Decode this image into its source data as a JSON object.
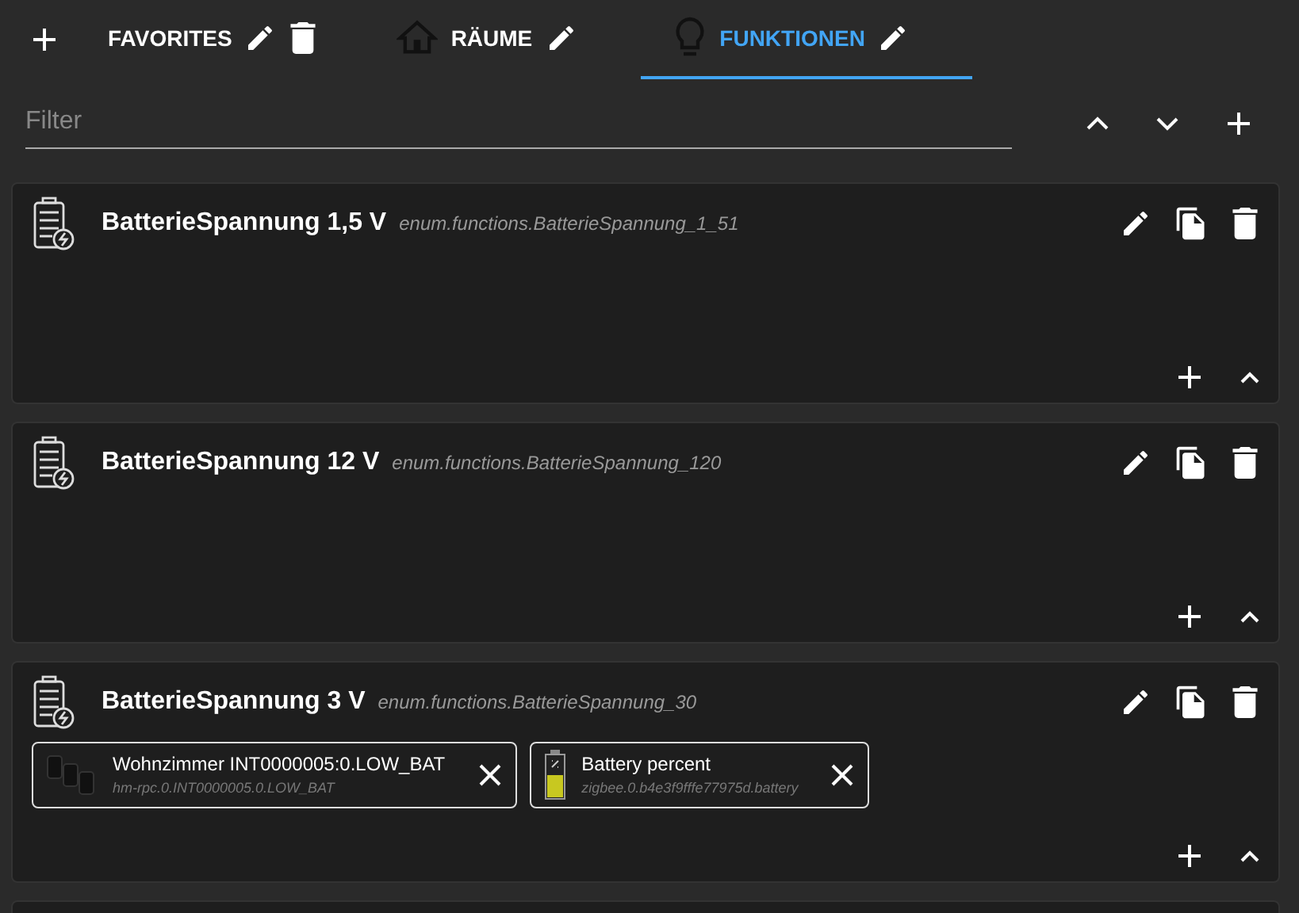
{
  "tabs": [
    {
      "label": "FAVORITES",
      "kind": "favorites",
      "selected": false,
      "deletable": true
    },
    {
      "label": "RÄUME",
      "kind": "rooms",
      "selected": false,
      "deletable": false
    },
    {
      "label": "FUNKTIONEN",
      "kind": "functions",
      "selected": true,
      "deletable": false
    }
  ],
  "filter": {
    "placeholder": "Filter"
  },
  "groups": [
    {
      "name": "BatterieSpannung 1,5 V",
      "id": "enum.functions.BatterieSpannung_1_51"
    },
    {
      "name": "BatterieSpannung 12 V",
      "id": "enum.functions.BatterieSpannung_120"
    },
    {
      "name": "BatterieSpannung 3 V",
      "id": "enum.functions.BatterieSpannung_30",
      "members": [
        {
          "kind": "device",
          "name": "Wohnzimmer INT0000005:0.LOW_BAT",
          "id": "hm-rpc.0.INT0000005.0.LOW_BAT"
        },
        {
          "kind": "battery",
          "name": "Battery percent",
          "id": "zigbee.0.b4e3f9fffe77975d.battery"
        }
      ]
    }
  ]
}
